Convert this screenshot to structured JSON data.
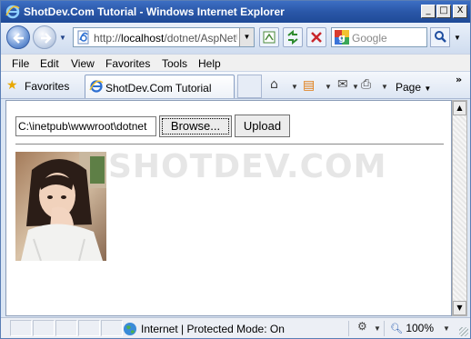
{
  "window": {
    "title": "ShotDev.Com Tutorial - Windows Internet Explorer",
    "controls": {
      "minimize": "_",
      "maximize": "□",
      "close": "X"
    }
  },
  "address_bar": {
    "url_prefix": "http://",
    "url_host": "localhost",
    "url_path": "/dotnet/AspNetU",
    "dropdown_glyph": "▼"
  },
  "search": {
    "placeholder": "Google",
    "engine_icon": "google-icon"
  },
  "menu": [
    "File",
    "Edit",
    "View",
    "Favorites",
    "Tools",
    "Help"
  ],
  "favorites": {
    "label": "Favorites"
  },
  "tab": {
    "label": "ShotDev.Com Tutorial"
  },
  "toolbar": {
    "page_label": "Page",
    "more_glyph": "»"
  },
  "page": {
    "watermark": "SHOTDEV.COM",
    "file_input_value": "C:\\inetpub\\wwwroot\\dotnet",
    "browse_label": "Browse...",
    "upload_label": "Upload"
  },
  "status": {
    "zone_label": "Internet | Protected Mode: On",
    "zoom_label": "100%"
  },
  "colors": {
    "titlebar": "#2a57a8",
    "chrome": "#dbe6f4",
    "watermark": "#e6e6e6"
  }
}
